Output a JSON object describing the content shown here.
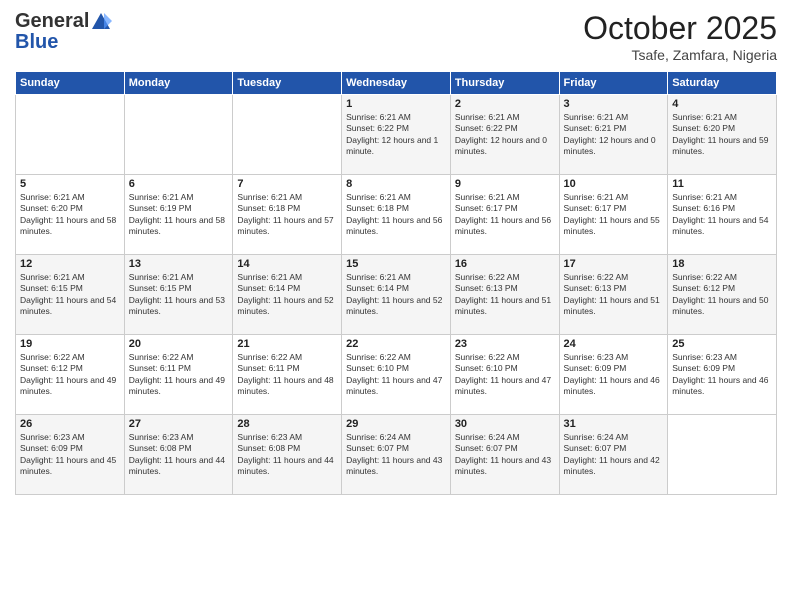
{
  "header": {
    "logo_general": "General",
    "logo_blue": "Blue",
    "month_title": "October 2025",
    "location": "Tsafe, Zamfara, Nigeria"
  },
  "days_of_week": [
    "Sunday",
    "Monday",
    "Tuesday",
    "Wednesday",
    "Thursday",
    "Friday",
    "Saturday"
  ],
  "weeks": [
    [
      {
        "day": "",
        "text": ""
      },
      {
        "day": "",
        "text": ""
      },
      {
        "day": "",
        "text": ""
      },
      {
        "day": "1",
        "text": "Sunrise: 6:21 AM\nSunset: 6:22 PM\nDaylight: 12 hours and 1 minute."
      },
      {
        "day": "2",
        "text": "Sunrise: 6:21 AM\nSunset: 6:22 PM\nDaylight: 12 hours and 0 minutes."
      },
      {
        "day": "3",
        "text": "Sunrise: 6:21 AM\nSunset: 6:21 PM\nDaylight: 12 hours and 0 minutes."
      },
      {
        "day": "4",
        "text": "Sunrise: 6:21 AM\nSunset: 6:20 PM\nDaylight: 11 hours and 59 minutes."
      }
    ],
    [
      {
        "day": "5",
        "text": "Sunrise: 6:21 AM\nSunset: 6:20 PM\nDaylight: 11 hours and 58 minutes."
      },
      {
        "day": "6",
        "text": "Sunrise: 6:21 AM\nSunset: 6:19 PM\nDaylight: 11 hours and 58 minutes."
      },
      {
        "day": "7",
        "text": "Sunrise: 6:21 AM\nSunset: 6:18 PM\nDaylight: 11 hours and 57 minutes."
      },
      {
        "day": "8",
        "text": "Sunrise: 6:21 AM\nSunset: 6:18 PM\nDaylight: 11 hours and 56 minutes."
      },
      {
        "day": "9",
        "text": "Sunrise: 6:21 AM\nSunset: 6:17 PM\nDaylight: 11 hours and 56 minutes."
      },
      {
        "day": "10",
        "text": "Sunrise: 6:21 AM\nSunset: 6:17 PM\nDaylight: 11 hours and 55 minutes."
      },
      {
        "day": "11",
        "text": "Sunrise: 6:21 AM\nSunset: 6:16 PM\nDaylight: 11 hours and 54 minutes."
      }
    ],
    [
      {
        "day": "12",
        "text": "Sunrise: 6:21 AM\nSunset: 6:15 PM\nDaylight: 11 hours and 54 minutes."
      },
      {
        "day": "13",
        "text": "Sunrise: 6:21 AM\nSunset: 6:15 PM\nDaylight: 11 hours and 53 minutes."
      },
      {
        "day": "14",
        "text": "Sunrise: 6:21 AM\nSunset: 6:14 PM\nDaylight: 11 hours and 52 minutes."
      },
      {
        "day": "15",
        "text": "Sunrise: 6:21 AM\nSunset: 6:14 PM\nDaylight: 11 hours and 52 minutes."
      },
      {
        "day": "16",
        "text": "Sunrise: 6:22 AM\nSunset: 6:13 PM\nDaylight: 11 hours and 51 minutes."
      },
      {
        "day": "17",
        "text": "Sunrise: 6:22 AM\nSunset: 6:13 PM\nDaylight: 11 hours and 51 minutes."
      },
      {
        "day": "18",
        "text": "Sunrise: 6:22 AM\nSunset: 6:12 PM\nDaylight: 11 hours and 50 minutes."
      }
    ],
    [
      {
        "day": "19",
        "text": "Sunrise: 6:22 AM\nSunset: 6:12 PM\nDaylight: 11 hours and 49 minutes."
      },
      {
        "day": "20",
        "text": "Sunrise: 6:22 AM\nSunset: 6:11 PM\nDaylight: 11 hours and 49 minutes."
      },
      {
        "day": "21",
        "text": "Sunrise: 6:22 AM\nSunset: 6:11 PM\nDaylight: 11 hours and 48 minutes."
      },
      {
        "day": "22",
        "text": "Sunrise: 6:22 AM\nSunset: 6:10 PM\nDaylight: 11 hours and 47 minutes."
      },
      {
        "day": "23",
        "text": "Sunrise: 6:22 AM\nSunset: 6:10 PM\nDaylight: 11 hours and 47 minutes."
      },
      {
        "day": "24",
        "text": "Sunrise: 6:23 AM\nSunset: 6:09 PM\nDaylight: 11 hours and 46 minutes."
      },
      {
        "day": "25",
        "text": "Sunrise: 6:23 AM\nSunset: 6:09 PM\nDaylight: 11 hours and 46 minutes."
      }
    ],
    [
      {
        "day": "26",
        "text": "Sunrise: 6:23 AM\nSunset: 6:09 PM\nDaylight: 11 hours and 45 minutes."
      },
      {
        "day": "27",
        "text": "Sunrise: 6:23 AM\nSunset: 6:08 PM\nDaylight: 11 hours and 44 minutes."
      },
      {
        "day": "28",
        "text": "Sunrise: 6:23 AM\nSunset: 6:08 PM\nDaylight: 11 hours and 44 minutes."
      },
      {
        "day": "29",
        "text": "Sunrise: 6:24 AM\nSunset: 6:07 PM\nDaylight: 11 hours and 43 minutes."
      },
      {
        "day": "30",
        "text": "Sunrise: 6:24 AM\nSunset: 6:07 PM\nDaylight: 11 hours and 43 minutes."
      },
      {
        "day": "31",
        "text": "Sunrise: 6:24 AM\nSunset: 6:07 PM\nDaylight: 11 hours and 42 minutes."
      },
      {
        "day": "",
        "text": ""
      }
    ]
  ]
}
